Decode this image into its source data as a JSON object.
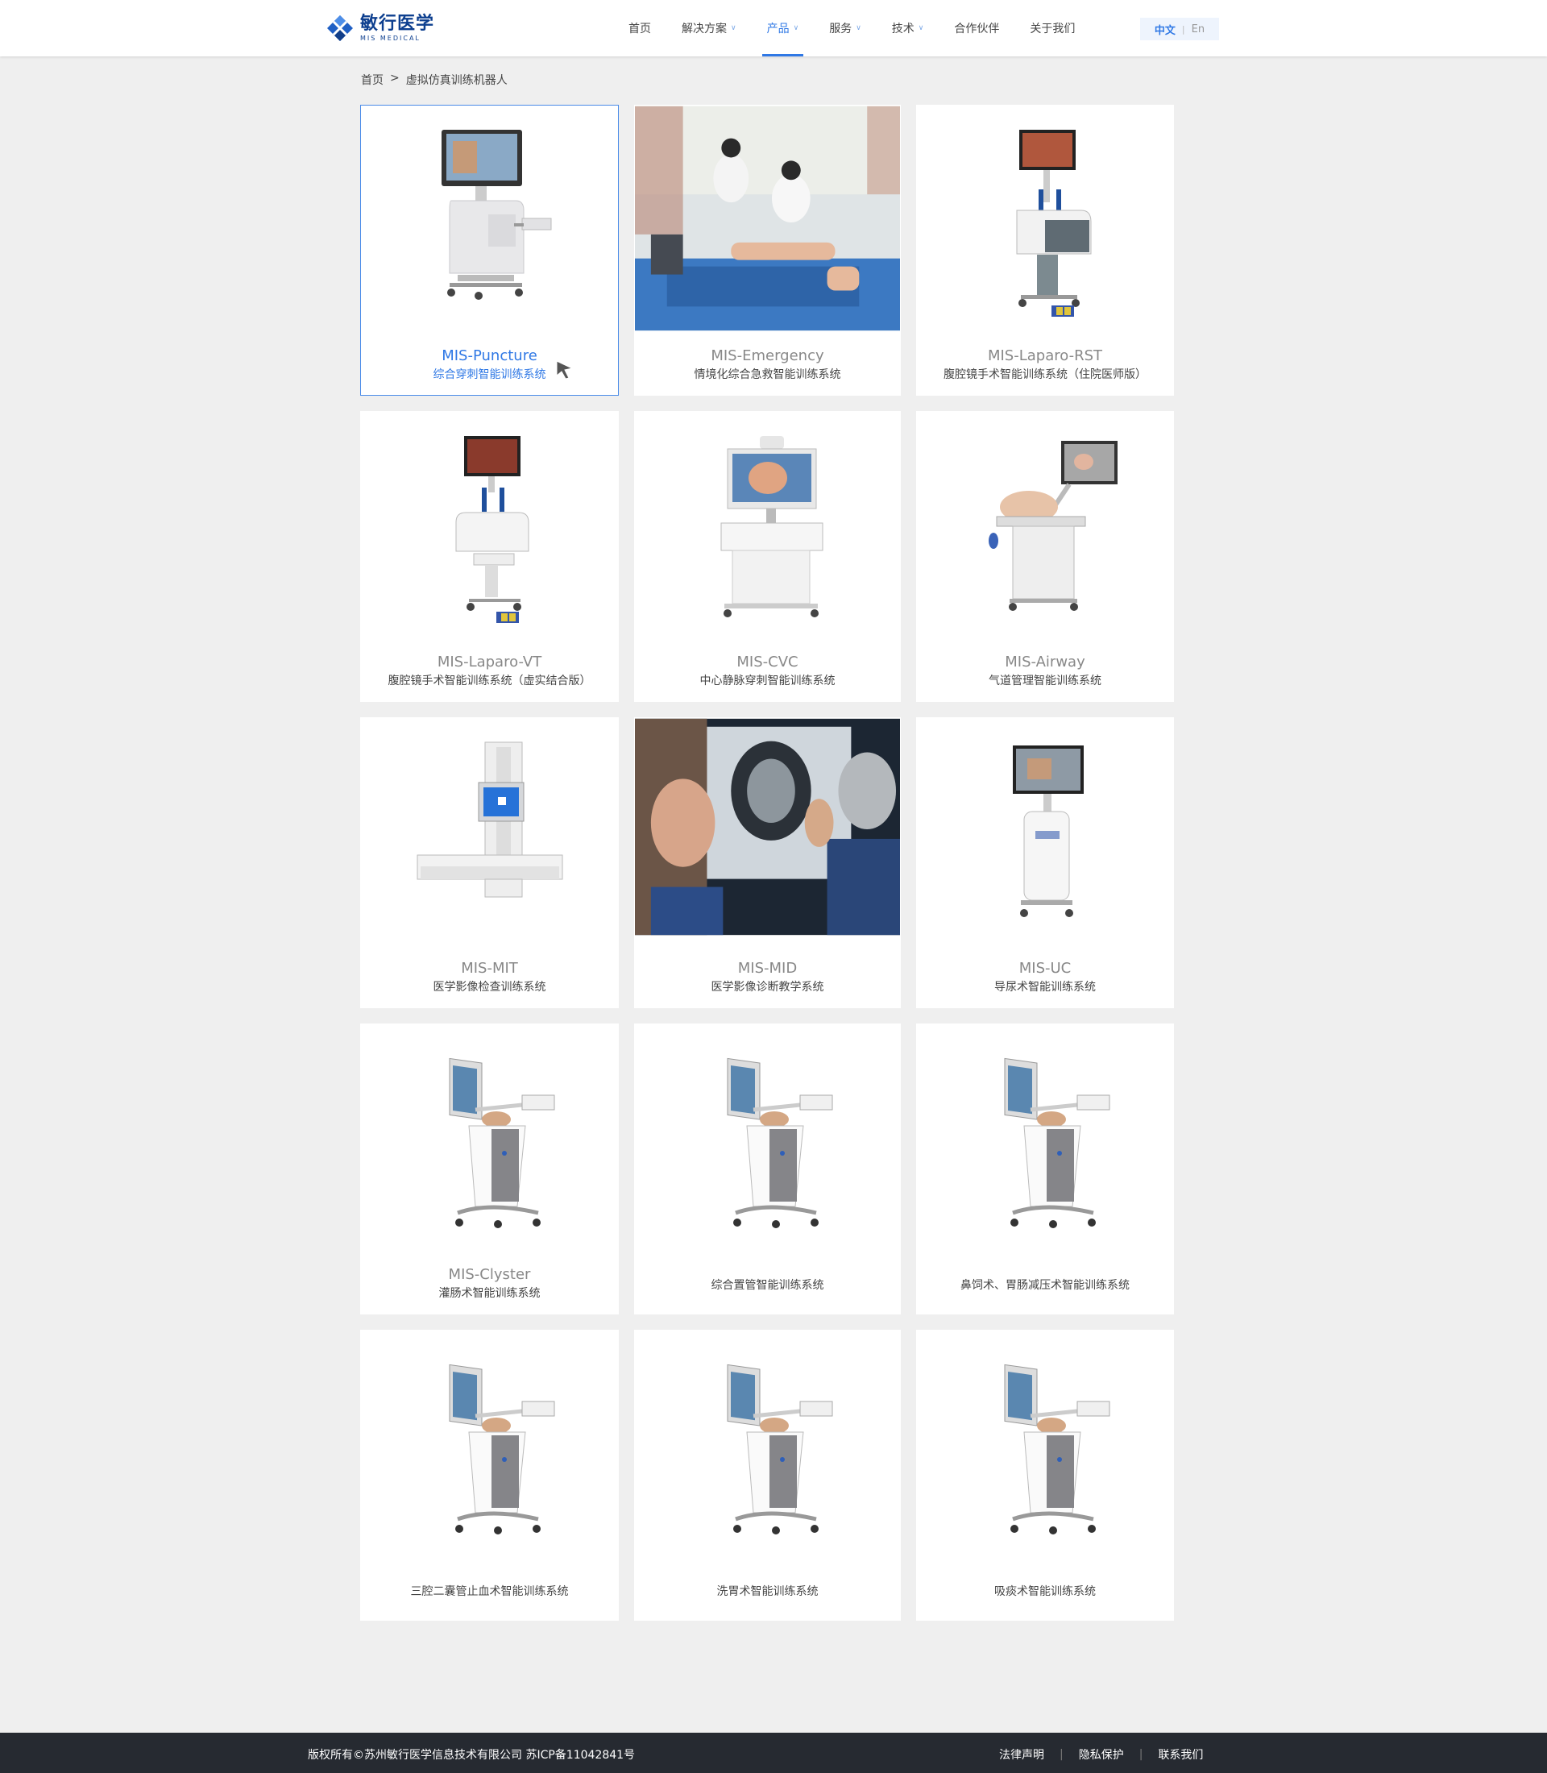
{
  "header": {
    "logo_cn": "敏行医学",
    "logo_en": "MIS MEDICAL",
    "nav": [
      {
        "label": "首页",
        "dropdown": false,
        "active": false
      },
      {
        "label": "解决方案",
        "dropdown": true,
        "active": false
      },
      {
        "label": "产品",
        "dropdown": true,
        "active": true
      },
      {
        "label": "服务",
        "dropdown": true,
        "active": false
      },
      {
        "label": "技术",
        "dropdown": true,
        "active": false
      },
      {
        "label": "合作伙伴",
        "dropdown": false,
        "active": false
      },
      {
        "label": "关于我们",
        "dropdown": false,
        "active": false
      }
    ],
    "lang": {
      "cn": "中文",
      "sep": "|",
      "en": "En"
    }
  },
  "breadcrumb": {
    "home": "首页",
    "sep": ">",
    "current": "虚拟仿真训练机器人"
  },
  "products": [
    {
      "name": "MIS-Puncture",
      "desc": "综合穿刺智能训练系统",
      "image": "puncture-cart"
    },
    {
      "name": "MIS-Emergency",
      "desc": "情境化综合急救智能训练系统",
      "image": "emergency-photo"
    },
    {
      "name": "MIS-Laparo-RST",
      "desc": "腹腔镜手术智能训练系统（住院医师版）",
      "image": "laparo-cart"
    },
    {
      "name": "MIS-Laparo-VT",
      "desc": "腹腔镜手术智能训练系统（虚实结合版）",
      "image": "laparo-cart-vt"
    },
    {
      "name": "MIS-CVC",
      "desc": "中心静脉穿刺智能训练系统",
      "image": "cvc-desk"
    },
    {
      "name": "MIS-Airway",
      "desc": "气道管理智能训练系统",
      "image": "airway-cart"
    },
    {
      "name": "MIS-MIT",
      "desc": "医学影像检查训练系统",
      "image": "mit-column"
    },
    {
      "name": "MIS-MID",
      "desc": "医学影像诊断教学系统",
      "image": "mid-photo"
    },
    {
      "name": "MIS-UC",
      "desc": "导尿术智能训练系统",
      "image": "uc-cart"
    },
    {
      "name": "MIS-Clyster",
      "desc": "灌肠术智能训练系统",
      "image": "clyster-cart"
    },
    {
      "name": "",
      "desc": "综合置管智能训练系统",
      "image": "clyster-cart"
    },
    {
      "name": "",
      "desc": "鼻饲术、胃肠减压术智能训练系统",
      "image": "clyster-cart"
    },
    {
      "name": "",
      "desc": "三腔二囊管止血术智能训练系统",
      "image": "clyster-cart"
    },
    {
      "name": "",
      "desc": "洗胃术智能训练系统",
      "image": "clyster-cart"
    },
    {
      "name": "",
      "desc": "吸痰术智能训练系统",
      "image": "clyster-cart"
    }
  ],
  "footer": {
    "copyright": "版权所有©苏州敏行医学信息技术有限公司  苏ICP备11042841号",
    "links": [
      "法律声明",
      "隐私保护",
      "联系我们"
    ],
    "divider": "|"
  },
  "colors": {
    "accent": "#2f78e5",
    "brand": "#0d3f8f",
    "footer_bg": "#262a31",
    "page_bg": "#efefef"
  }
}
